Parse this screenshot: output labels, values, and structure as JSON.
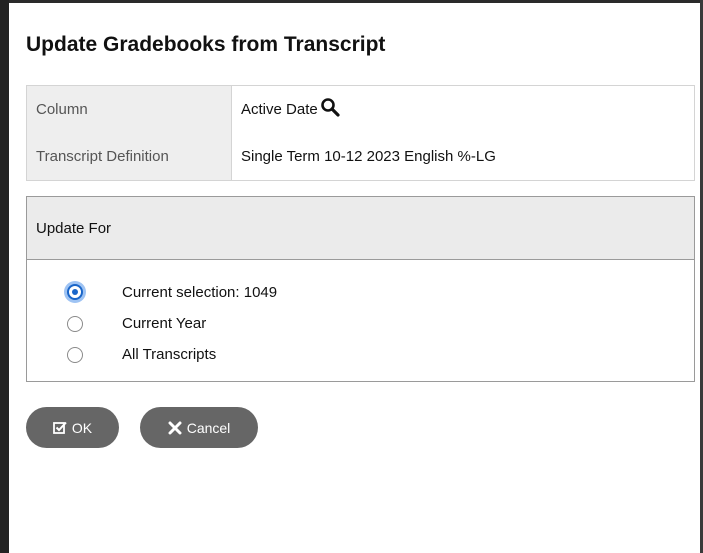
{
  "dialog": {
    "title": "Update Gradebooks from Transcript"
  },
  "fields": [
    {
      "label": "Column",
      "value": "Active Date",
      "icon": "search-icon"
    },
    {
      "label": "Transcript Definition",
      "value": "Single Term 10-12 2023 English %-LG"
    }
  ],
  "update_for": {
    "heading": "Update For",
    "options": [
      {
        "label": "Current selection: 1049",
        "checked": true
      },
      {
        "label": "Current Year",
        "checked": false
      },
      {
        "label": "All Transcripts",
        "checked": false
      }
    ]
  },
  "buttons": {
    "ok_label": "OK",
    "ok_icon": "checkbox-icon",
    "cancel_label": "Cancel",
    "cancel_icon": "close-icon"
  },
  "colors": {
    "button_bg": "#666666",
    "radio_selected": "#1a66c9",
    "panel_bg": "#eeeeee"
  }
}
